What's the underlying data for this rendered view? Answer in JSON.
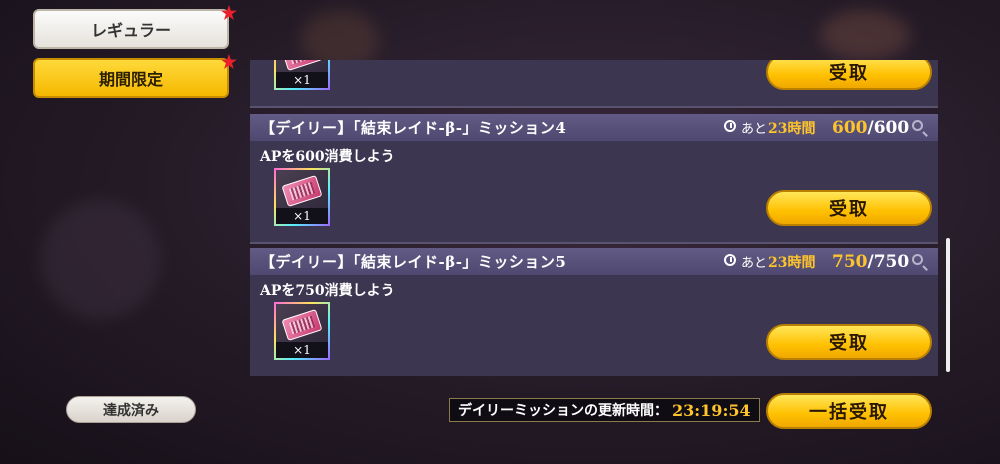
{
  "tabs": {
    "regular": "レギュラー",
    "limited": "期間限定"
  },
  "missions": [
    {
      "title": "",
      "timer_prefix": "",
      "timer_value": "",
      "progress_current": "",
      "progress_max": "",
      "description": "",
      "reward_qty": "×1",
      "claim_label": "受取"
    },
    {
      "title": "【デイリー】「結束レイド-β-」ミッション4",
      "timer_prefix": "あと",
      "timer_value": "23時間",
      "progress_current": "600",
      "progress_max": "600",
      "description": "APを600消費しよう",
      "reward_qty": "×1",
      "claim_label": "受取"
    },
    {
      "title": "【デイリー】「結束レイド-β-」ミッション5",
      "timer_prefix": "あと",
      "timer_value": "23時間",
      "progress_current": "750",
      "progress_max": "750",
      "description": "APを750消費しよう",
      "reward_qty": "×1",
      "claim_label": "受取"
    }
  ],
  "footer": {
    "completed_label": "達成済み",
    "refresh_label": "デイリーミッションの更新時間：",
    "refresh_time": "23:19:54",
    "claim_all_label": "一括受取"
  },
  "colors": {
    "accent_gold": "#ffc42b",
    "button_yellow": "#ffc000",
    "header_purple": "#5a5480",
    "card_bg": "#3c3650",
    "badge_red": "#e8202a"
  },
  "icons": {
    "timer": "timer-icon",
    "search": "search-icon",
    "badge": "star-badge-icon",
    "reward": "ticket-icon"
  }
}
